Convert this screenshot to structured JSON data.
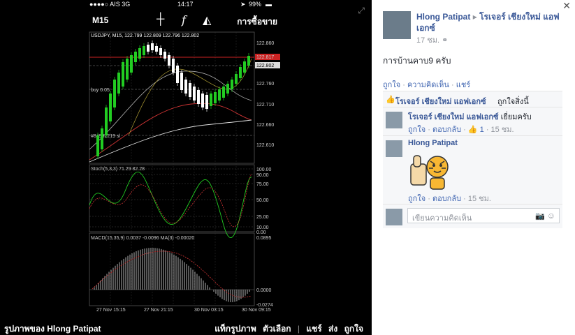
{
  "status_bar": {
    "carrier": "●●●●○ AIS  3G",
    "time": "14:17",
    "battery": "99%"
  },
  "app_header": {
    "timeframe": "M15",
    "crosshair_icon": "crosshair-icon",
    "indicator_icon": "function-icon",
    "objects_icon": "shapes-icon",
    "buy_sell_label": "การซื้อขาย"
  },
  "chart": {
    "symbol_line": "USDJPY, M15, 122.799 122.809 122.796 122.802",
    "price_labels": [
      "122.860",
      "122.817",
      "122.802",
      "122.760",
      "122.710",
      "122.660",
      "122.610"
    ],
    "order_label": "buy 0.05",
    "ticket_label": "#84932219 sl",
    "stoch_title": "Stoch(5,3,3) 71.29 82.28",
    "stoch_levels": [
      "100.00",
      "90.00",
      "75.00",
      "50.00",
      "25.00",
      "10.00",
      "0.00"
    ],
    "macd_title": "MACD(15,35,9) 0.0037 -0.0096 MA(3) -0.00020",
    "macd_levels": [
      "0.0895",
      "0.0000",
      "-0.0274"
    ],
    "time_labels": [
      "27 Nov 15:15",
      "27 Nov 21:15",
      "30 Nov 03:15",
      "30 Nov 09:15"
    ],
    "colors": {
      "bull": "#22cc22",
      "bear": "#ffffff",
      "grid": "#333333",
      "sl_line": "#cc2222"
    }
  },
  "photo_viewer": {
    "caption": "รูปภาพของ Hlong Patipat",
    "tag_photo": "แท็กรูปภาพ",
    "options": "ตัวเลือก",
    "share": "แชร์",
    "send": "ส่ง",
    "like": "ถูกใจ"
  },
  "post": {
    "author": "Hlong Patipat",
    "target": "โรเจอร์ เชียงใหม่ แอฟเอกซ์",
    "time": "17 ชม.",
    "privacy_icon": "friends-icon",
    "text": "การบ้านคาบ9 ครับ",
    "actions": {
      "like": "ถูกใจ",
      "comment": "ความคิดเห็น",
      "share": "แชร์"
    },
    "likes_summary_name": "โรเจอร์ เชียงใหม่ แอฟเอกซ์",
    "likes_summary_text": "ถูกใจสิ่งนี้"
  },
  "comments": [
    {
      "author": "โรเจอร์ เชียงใหม่ แอฟเอกซ์",
      "text": "เยี่ยมครับ",
      "like": "ถูกใจ",
      "reply": "ตอบกลับ",
      "like_count": "1",
      "time": "15 ชม."
    },
    {
      "author": "Hlong Patipat",
      "text": "",
      "sticker": "thumbs-up-tiger-sticker",
      "like": "ถูกใจ",
      "reply": "ตอบกลับ",
      "time": "15 ชม."
    }
  ],
  "comment_input": {
    "placeholder": "เขียนความคิดเห็น",
    "camera_icon": "camera-icon",
    "emoji_icon": "smiley-icon"
  }
}
